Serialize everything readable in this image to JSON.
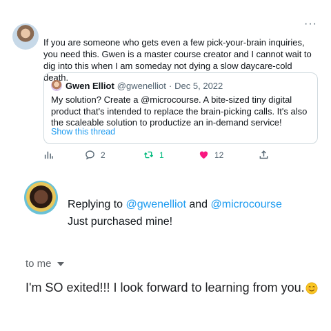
{
  "tweet": {
    "more_label": "···",
    "text": "If you are someone who gets even a few pick-your-brain inquiries, you need this. Gwen is a master course creator and I cannot wait to dig into this when I am someday not dying a slow daycare-cold death.",
    "quote": {
      "name": "Gwen Elliot",
      "handle": "@gwenelliot",
      "separator": "·",
      "date": "Dec 5, 2022",
      "text": "My solution? Create a @microcourse. A bite-sized tiny digital product that's intended to replace the brain-picking calls. It's also the scaleable solution to productize an in-demand service!",
      "show_thread": "Show this thread"
    },
    "actions": {
      "replies": "2",
      "retweets": "1",
      "likes": "12"
    },
    "colors": {
      "like": "#f91880",
      "retweet": "#00ba7c",
      "link": "#1d9bf0"
    }
  },
  "reply": {
    "replying_prefix": "Replying to",
    "mention1": "@gwenelliot",
    "and": "and",
    "mention2": "@microcourse",
    "text": "Just purchased mine!"
  },
  "email": {
    "recipient_label": "to me",
    "body": "I'm SO exited!!! I look forward to learning from you.",
    "emoji": "smiling-face-emoji"
  }
}
